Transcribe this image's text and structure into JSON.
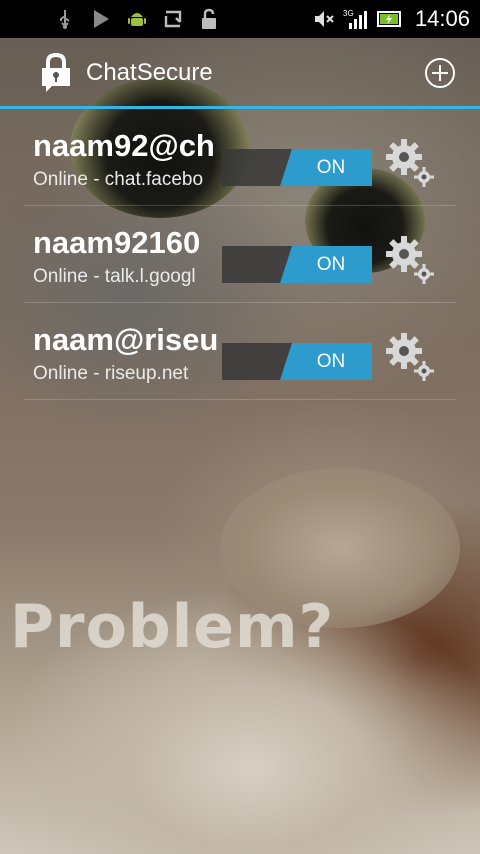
{
  "status_bar": {
    "time": "14:06",
    "network_type": "3G",
    "icons": [
      "usb-icon",
      "play-store-icon",
      "android-icon",
      "sync-icon",
      "unlock-icon",
      "mute-icon",
      "signal-icon",
      "battery-charging-icon"
    ]
  },
  "action_bar": {
    "app_title": "ChatSecure",
    "icons": [
      "app-lock-icon",
      "add-account-icon"
    ]
  },
  "accounts": [
    {
      "name": "naam92@ch",
      "status": "Online - chat.facebo",
      "toggle": "ON"
    },
    {
      "name": "naam92160",
      "status": "Online - talk.l.googl",
      "toggle": "ON"
    },
    {
      "name": "naam@riseu",
      "status": "Online - riseup.net",
      "toggle": "ON"
    }
  ],
  "background_text": "Problem?",
  "colors": {
    "accent": "#33b5e5",
    "toggle_on": "#2d9ccc"
  }
}
